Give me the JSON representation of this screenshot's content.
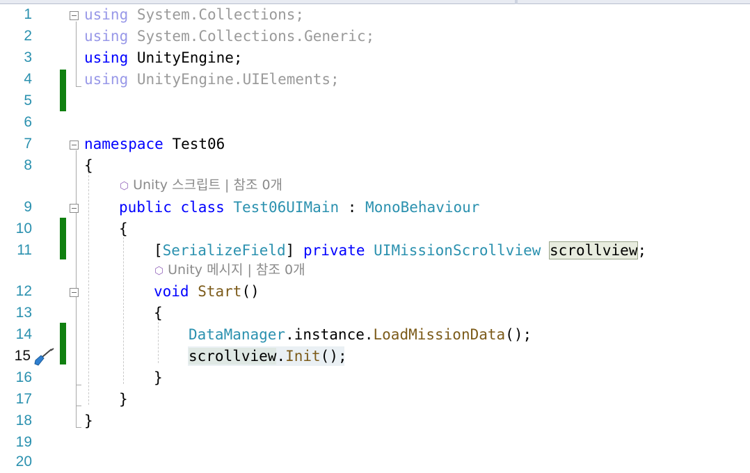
{
  "editor": {
    "lines": [
      {
        "n": "1"
      },
      {
        "n": "2"
      },
      {
        "n": "3"
      },
      {
        "n": "4"
      },
      {
        "n": "5"
      },
      {
        "n": "6"
      },
      {
        "n": "7"
      },
      {
        "n": "8"
      },
      {
        "n": "9"
      },
      {
        "n": "10"
      },
      {
        "n": "11"
      },
      {
        "n": "12"
      },
      {
        "n": "13"
      },
      {
        "n": "14"
      },
      {
        "n": "15"
      },
      {
        "n": "16"
      },
      {
        "n": "17"
      },
      {
        "n": "18"
      },
      {
        "n": "19"
      },
      {
        "n": "20"
      }
    ],
    "code": {
      "l1": {
        "kw": "using",
        "rest": " System.Collections;"
      },
      "l2": {
        "kw": "using",
        "rest": " System.Collections.Generic;"
      },
      "l3": {
        "kw": "using",
        "rest": " UnityEngine;"
      },
      "l4": {
        "kw": "using",
        "rest": " UnityEngine.UIElements;"
      },
      "l7": {
        "kw": "namespace",
        "rest": " Test06"
      },
      "l8": {
        "text": "{"
      },
      "l9": {
        "kw1": "public",
        "sp1": " ",
        "kw2": "class",
        "sp2": " ",
        "cls": "Test06UIMain",
        "colon": " : ",
        "base": "MonoBehaviour"
      },
      "l10": {
        "text": "{"
      },
      "l11": {
        "lb": "[",
        "attr": "SerializeField",
        "rb": "]",
        "sp1": " ",
        "kw": "private",
        "sp2": " ",
        "type": "UIMissionScrollview",
        "sp3": " ",
        "name": "scrollview",
        "end": ";"
      },
      "l12": {
        "kw": "void",
        "sp": " ",
        "name": "Start",
        "parens": "()"
      },
      "l13": {
        "text": "{"
      },
      "l14": {
        "cls": "DataManager",
        "mid": ".instance.",
        "method": "LoadMissionData",
        "end": "();"
      },
      "l15": {
        "ref": "scrollview",
        "dot": ".",
        "method": "Init",
        "end": "();"
      },
      "l16": {
        "text": "}"
      },
      "l17": {
        "text": "}"
      },
      "l18": {
        "text": "}"
      }
    },
    "codelens": {
      "class": {
        "label": "Unity 스크립트 | 참조 0개"
      },
      "method": {
        "label": "Unity 메시지 | 참조 0개"
      }
    },
    "icons": {
      "codelens": "unity-cube-icon",
      "breakpoint_pin": "screwdriver-pin-icon",
      "fold": "collapse-minus-icon"
    },
    "colors": {
      "keyword": "#0000ff",
      "type": "#2b91af",
      "method": "#7c5b1a",
      "line_number": "#2b91af",
      "change_bar": "#108010"
    }
  }
}
